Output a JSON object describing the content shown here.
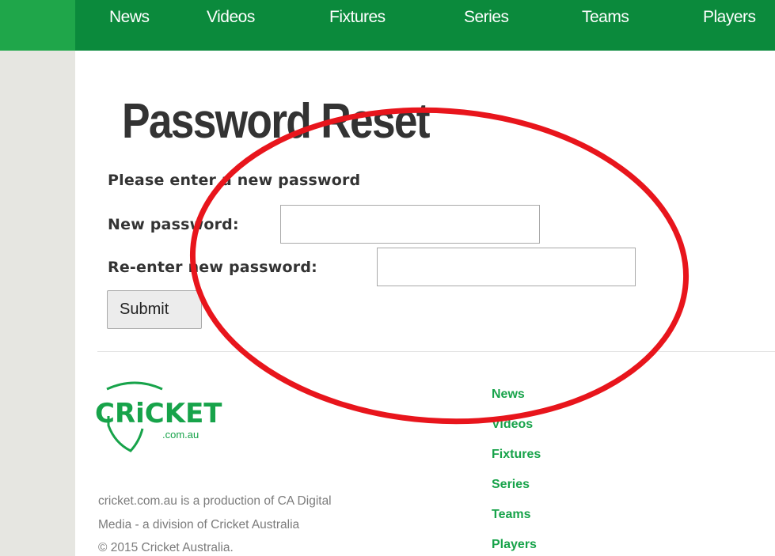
{
  "colors": {
    "nav_background": "#0b8a3c",
    "nav_left_accent": "#1fa64a",
    "gutter": "#e6e6e1",
    "footer_link": "#17a34a",
    "annotation_red": "#e8151c"
  },
  "nav": {
    "items": [
      "News",
      "Videos",
      "Fixtures",
      "Series",
      "Teams",
      "Players"
    ]
  },
  "page": {
    "title": "Password Reset",
    "instruction": "Please enter a new password"
  },
  "form": {
    "new_password_label": "New password:",
    "new_password_value": "",
    "reenter_password_label": "Re-enter new password:",
    "reenter_password_value": "",
    "submit_label": "Submit"
  },
  "footer": {
    "logo_text": "CRiCKET",
    "logo_subtext": ".com.au",
    "about_lines": [
      "cricket.com.au is a production of CA Digital",
      "Media - a division of Cricket Australia",
      "© 2015 Cricket Australia."
    ],
    "links": [
      "News",
      "Videos",
      "Fixtures",
      "Series",
      "Teams",
      "Players"
    ]
  }
}
